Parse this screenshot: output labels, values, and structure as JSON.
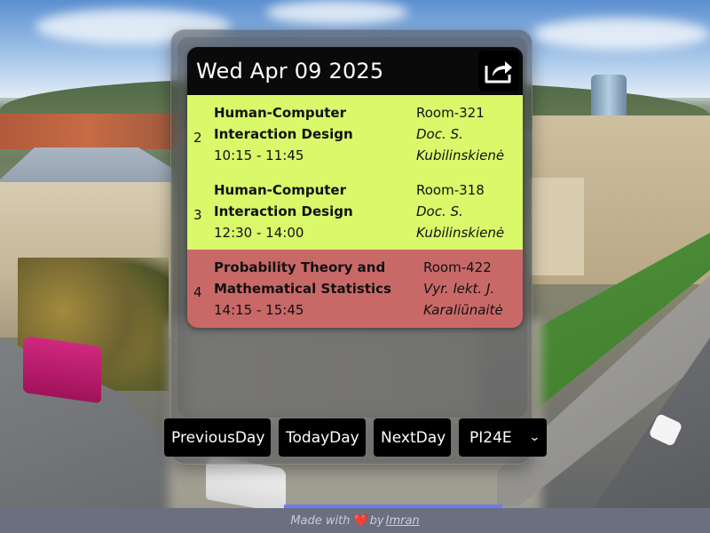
{
  "header": {
    "date": "Wed Apr 09 2025",
    "share_icon": "share-icon"
  },
  "lessons": [
    {
      "number": "2",
      "title_line1": "Human-Computer",
      "title_line2": "Interaction Design",
      "time": "10:15 - 11:45",
      "room": "Room-321",
      "teacher_line1": "Doc. S.",
      "teacher_line2": "Kubilinskienė",
      "color": "#d9f86a"
    },
    {
      "number": "3",
      "title_line1": "Human-Computer",
      "title_line2": "Interaction Design",
      "time": "12:30 - 14:00",
      "room": "Room-318",
      "teacher_line1": "Doc. S.",
      "teacher_line2": "Kubilinskienė",
      "color": "#d9f86a"
    },
    {
      "number": "4",
      "title_line1": "Probability Theory and",
      "title_line2": "Mathematical Statistics",
      "time": "14:15 - 15:45",
      "room": "Room-422",
      "teacher_line1": "Vyr. lekt. J.",
      "teacher_line2": "Karaliūnaitė",
      "color": "#c86968"
    }
  ],
  "nav": {
    "previous_label": "PreviousDay",
    "today_label": "TodayDay",
    "next_label": "NextDay",
    "group_selected": "PI24E"
  },
  "footer": {
    "made_with": "Made with",
    "by": "by",
    "author": "Imran"
  }
}
